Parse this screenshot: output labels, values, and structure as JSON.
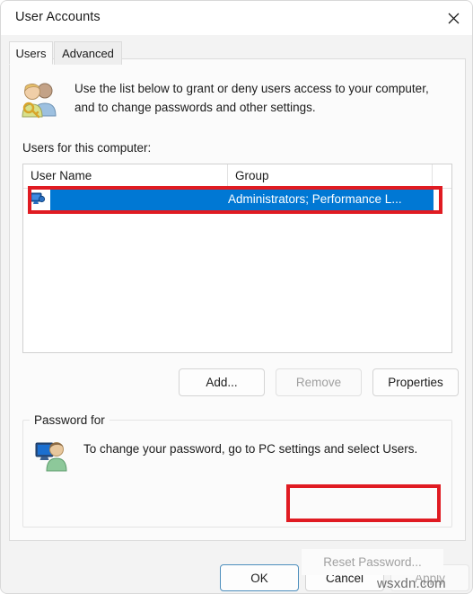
{
  "window": {
    "title": "User Accounts",
    "close_icon": "close-icon"
  },
  "tabs": [
    {
      "label": "Users",
      "active": true
    },
    {
      "label": "Advanced",
      "active": false
    }
  ],
  "users_tab": {
    "blurb_icon": "two-users-key-icon",
    "blurb": "Use the list below to grant or deny users access to your computer, and to change passwords and other settings.",
    "list_label": "Users for this computer:",
    "list": {
      "columns": [
        "User Name",
        "Group"
      ],
      "rows": [
        {
          "icon": "user-computer-icon",
          "user_name": "",
          "group": "Administrators; Performance L...",
          "selected": true
        }
      ]
    },
    "buttons": [
      {
        "label": "Add...",
        "enabled": true
      },
      {
        "label": "Remove",
        "enabled": false
      },
      {
        "label": "Properties",
        "enabled": true
      }
    ],
    "password_group": {
      "legend": "Password for",
      "icon": "user-monitor-icon",
      "text": "To change your password, go to PC settings and select Users.",
      "reset_button": {
        "label": "Reset Password...",
        "enabled": false
      }
    }
  },
  "footer": {
    "ok": "OK",
    "cancel": "Cancel",
    "apply": "Apply"
  },
  "watermark": "wsxdn.com",
  "colors": {
    "selection_blue": "#0078d4",
    "highlight_red": "#e01b22",
    "default_button_border": "#4e8fbd",
    "disabled_text": "#a0a0a0"
  }
}
